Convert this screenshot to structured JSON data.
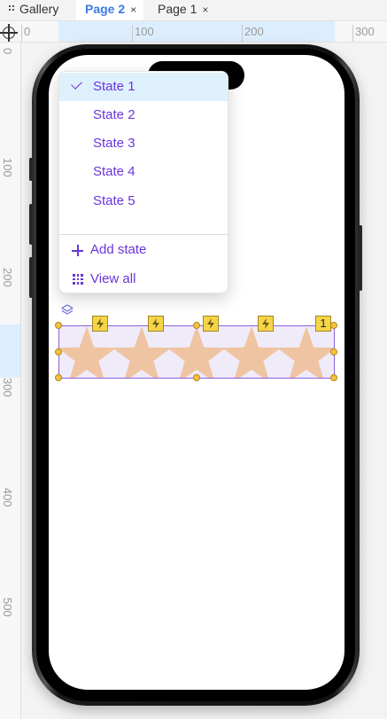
{
  "tabs": [
    {
      "label": "Gallery",
      "closable": false,
      "active": false
    },
    {
      "label": "Page 2",
      "closable": true,
      "active": true
    },
    {
      "label": "Page 1",
      "closable": true,
      "active": false
    }
  ],
  "ruler": {
    "horizontal_labels": [
      "0",
      "100",
      "200",
      "300"
    ],
    "vertical_labels": [
      "0",
      "100",
      "200",
      "300",
      "400",
      "500"
    ]
  },
  "state_menu": {
    "states": [
      {
        "label": "State 1",
        "selected": true
      },
      {
        "label": "State 2",
        "selected": false
      },
      {
        "label": "State 3",
        "selected": false
      },
      {
        "label": "State 4",
        "selected": false
      },
      {
        "label": "State 5",
        "selected": false
      }
    ],
    "add_state_label": "Add state",
    "view_all_label": "View all"
  },
  "rating": {
    "star_count": 5,
    "interaction_count": "1",
    "star_color": "#efc4a2",
    "background_color": "#f0ebf9",
    "selection_color": "#8a62d8"
  },
  "colors": {
    "accent": "#6a35d9",
    "tab_active_text": "#3b7de0",
    "handle": "#f6c23b",
    "badge": "#f5d547",
    "highlight": "#dceefd"
  }
}
